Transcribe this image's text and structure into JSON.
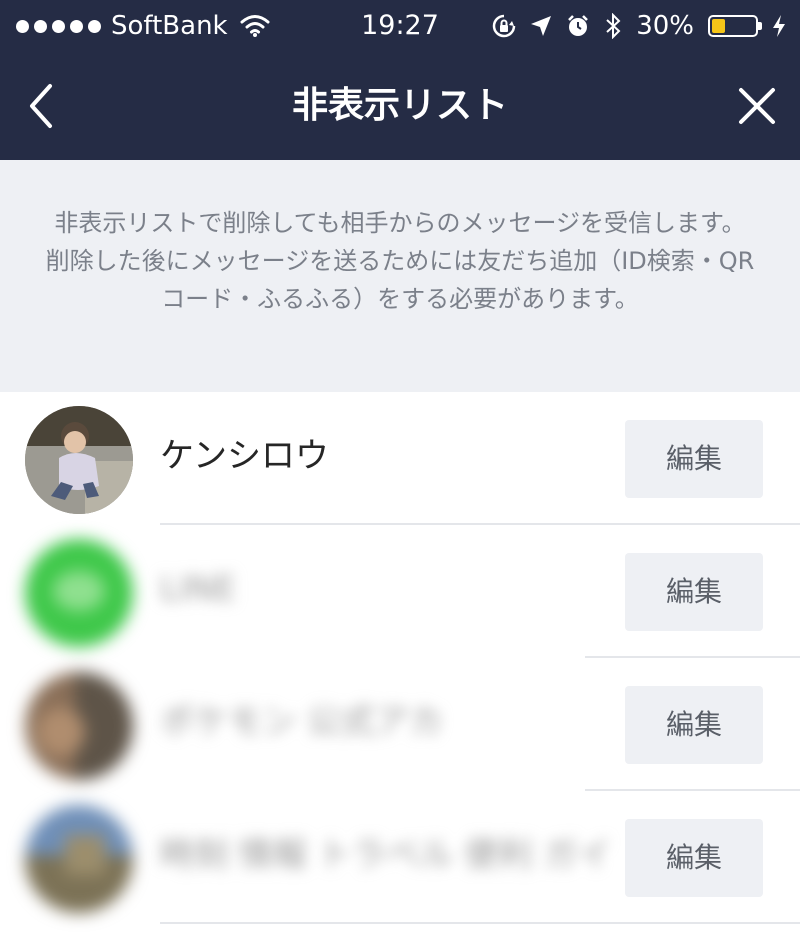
{
  "status_bar": {
    "carrier": "SoftBank",
    "time": "19:27",
    "battery_percent": "30%",
    "battery_level": 0.3,
    "icons": [
      "signal-dots-icon",
      "wifi-icon",
      "rotation-lock-icon",
      "location-arrow-icon",
      "alarm-icon",
      "bluetooth-icon",
      "battery-icon",
      "charging-bolt-icon"
    ]
  },
  "nav": {
    "title": "非表示リスト",
    "back_icon": "chevron-left-icon",
    "close_icon": "close-icon"
  },
  "notice": {
    "line1": "非表示リストで削除しても相手からのメッセージを受信します。",
    "line2": "削除した後にメッセージを送るためには友だち追加（ID検索・QRコード・ふるふる）をする必要があります。"
  },
  "colors": {
    "nav_bg": "#252c45",
    "notice_bg": "#eef0f4",
    "battery_fill": "#f5c518",
    "line_green": "#3fc84a"
  },
  "rows": [
    {
      "name": "ケンシロウ",
      "edit_label": "編集",
      "blurred": false
    },
    {
      "name": "LINE",
      "edit_label": "編集",
      "blurred": true
    },
    {
      "name": "ポケモン 公式アカ",
      "edit_label": "編集",
      "blurred": true
    },
    {
      "name": "時刻 情報 トラベル 便利 ガイ",
      "edit_label": "編集",
      "blurred": true
    }
  ]
}
